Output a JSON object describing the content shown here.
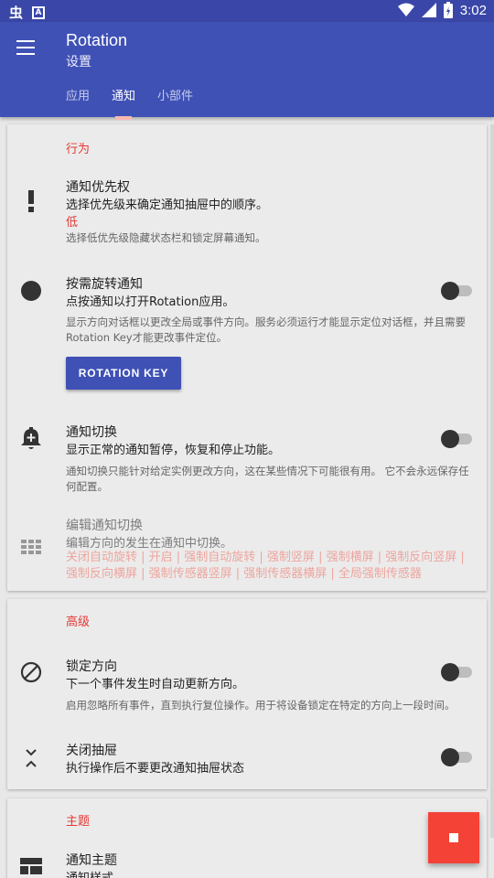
{
  "statusbar": {
    "time": "3:02",
    "left_icon_a": "A",
    "left_icon_bug": "虫"
  },
  "appbar": {
    "title": "Rotation",
    "subtitle": "设置",
    "tabs": [
      {
        "label": "应用",
        "active": false
      },
      {
        "label": "通知",
        "active": true
      },
      {
        "label": "小部件",
        "active": false
      }
    ]
  },
  "behavior": {
    "title": "行为",
    "priority": {
      "title": "通知优先权",
      "summary": "选择优先级来确定通知抽屉中的顺序。",
      "value": "低",
      "desc": "选择低优先级隐藏状态栏和锁定屏幕通知。",
      "icon": "priority-exclamation-icon"
    },
    "on_demand": {
      "title": "按需旋转通知",
      "summary": "点按通知以打开Rotation应用。",
      "desc": "显示方向对话框以更改全局或事件方向。服务必须运行才能显示定位对话框，并且需要Rotation Key才能更改事件定位。",
      "button_label": "ROTATION KEY",
      "switch_on": false,
      "icon": "filled-circle-icon"
    },
    "toggle": {
      "title": "通知切换",
      "summary": "显示正常的通知暂停，恢复和停止功能。",
      "desc": "通知切换只能针对给定实例更改方向，这在某些情况下可能很有用。 它不会永远保存任何配置。",
      "switch_on": false,
      "icon": "bell-plus-icon"
    },
    "edit_toggle": {
      "title": "编辑通知切换",
      "summary": "编辑方向的发生在通知中切换。",
      "options": "关闭自动旋转 | 开启 | 强制自动旋转 | 强制竖屏 | 强制横屏 | 强制反向竖屏 | 强制反向横屏 | 强制传感器竖屏 | 强制传感器横屏 | 全局强制传感器",
      "enabled": false,
      "icon": "grid-icon"
    }
  },
  "advanced": {
    "title": "高级",
    "lock": {
      "title": "锁定方向",
      "summary": "下一个事件发生时自动更新方向。",
      "desc": "启用忽略所有事件，直到执行复位操作。用于将设备锁定在特定的方向上一段时间。",
      "switch_on": false,
      "icon": "block-icon"
    },
    "close_drawer": {
      "title": "关闭抽屉",
      "summary": "执行操作后不要更改通知抽屉状态",
      "switch_on": false,
      "icon": "collapse-chevrons-icon"
    }
  },
  "theme": {
    "title": "主题",
    "notif_theme": {
      "title": "通知主题",
      "summary": "通知样式。",
      "icon": "layout-icon"
    }
  },
  "fab": {
    "icon": "stop-icon"
  }
}
